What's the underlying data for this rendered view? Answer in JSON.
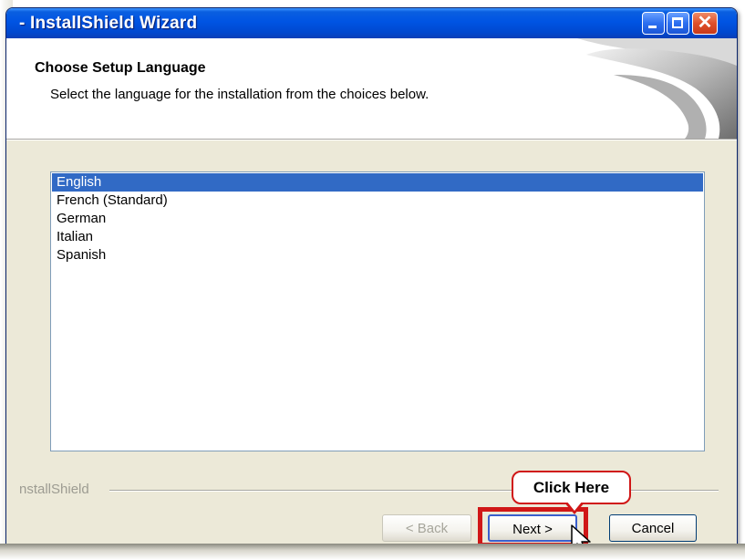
{
  "window": {
    "title": "- InstallShield Wizard",
    "controls": [
      "minimize-icon",
      "maximize-icon",
      "close-icon"
    ],
    "close_glyph": "✕"
  },
  "header": {
    "title": "Choose Setup Language",
    "subtitle": "Select the language for the installation from the choices below."
  },
  "languages": {
    "items": [
      "English",
      "French (Standard)",
      "German",
      "Italian",
      "Spanish"
    ],
    "selected": "English"
  },
  "branding": {
    "text": "nstallShield"
  },
  "buttons": {
    "back": "< Back",
    "next": "Next >",
    "cancel": "Cancel"
  },
  "annotation": {
    "callout": "Click Here",
    "highlight_color": "#d01717"
  },
  "colors": {
    "titlebar": "#0054e3",
    "selection": "#316ac5",
    "dialog_bg": "#ece9d8"
  }
}
